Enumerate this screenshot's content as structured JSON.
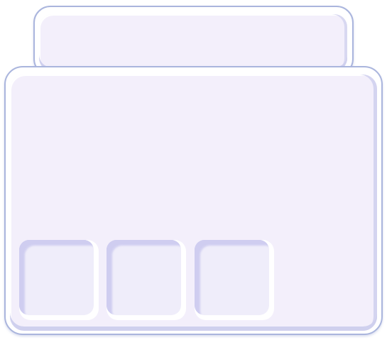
{
  "window": {
    "header_panel": {},
    "body_panel": {
      "slots": [
        {},
        {},
        {}
      ]
    }
  },
  "colors": {
    "outline": "#aab5dd",
    "panel_fill": "#f3effb",
    "shadow": "#cfd0ee",
    "slot_fill": "#efedfa",
    "slot_inset": "#cfcdf0"
  }
}
